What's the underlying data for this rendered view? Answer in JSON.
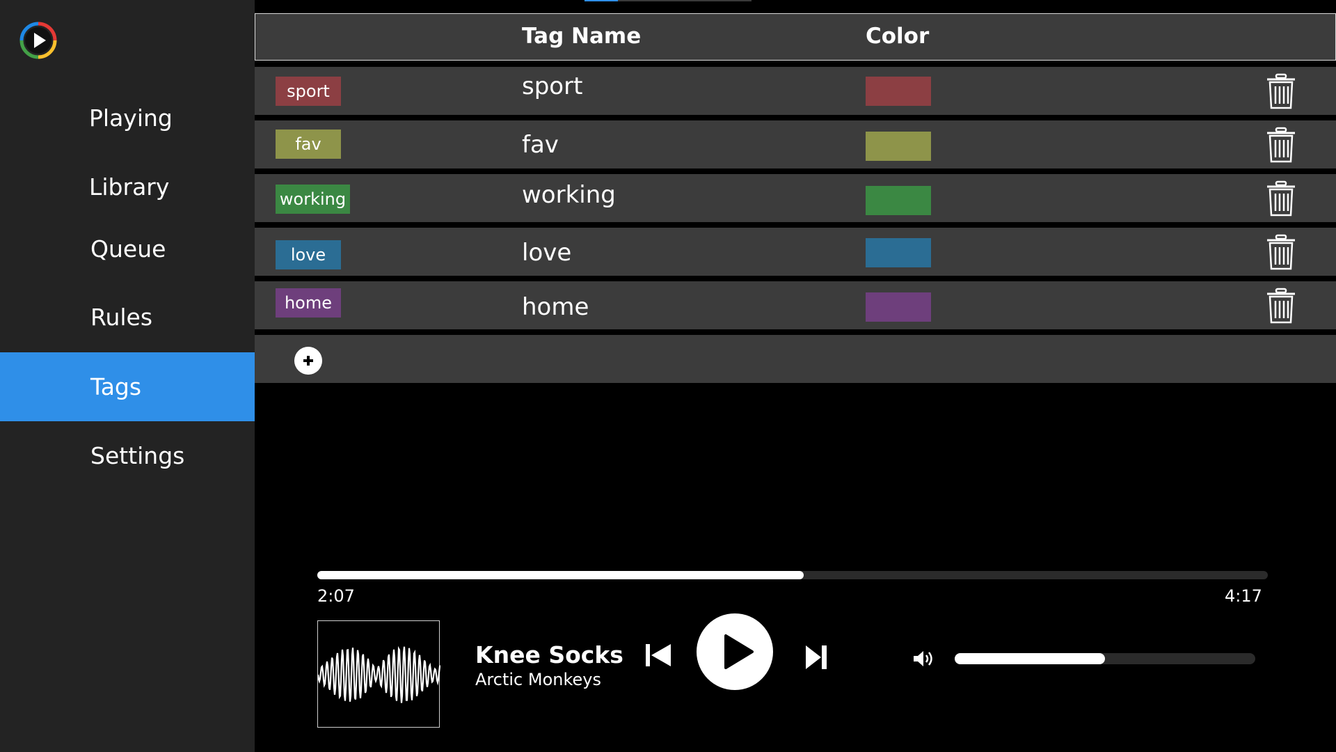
{
  "nav": {
    "items": [
      {
        "label": "Playing"
      },
      {
        "label": "Library"
      },
      {
        "label": "Queue"
      },
      {
        "label": "Rules"
      },
      {
        "label": "Tags"
      },
      {
        "label": "Settings"
      }
    ],
    "active": "Tags",
    "accent_color": "#2f8fe8"
  },
  "table": {
    "headers": {
      "tag_name": "Tag Name",
      "color": "Color"
    },
    "rows": [
      {
        "chip": "sport",
        "name": "sport",
        "color": "#8c3f43"
      },
      {
        "chip": "fav",
        "name": "fav",
        "color": "#8e944a"
      },
      {
        "chip": "working",
        "name": "working",
        "color": "#3b8843"
      },
      {
        "chip": "love",
        "name": "love",
        "color": "#2b6d94"
      },
      {
        "chip": "home",
        "name": "home",
        "color": "#6e3f7c"
      }
    ],
    "delete_icon": "trash-icon",
    "add_icon": "plus-circle-icon"
  },
  "player": {
    "elapsed": "2:07",
    "duration": "4:17",
    "progress_fraction": 0.512,
    "track_title": "Knee Socks",
    "artist": "Arctic Monkeys",
    "volume_fraction": 0.5,
    "icons": {
      "prev": "skip-previous-icon",
      "play": "play-icon",
      "next": "skip-next-icon",
      "volume": "volume-icon"
    }
  }
}
